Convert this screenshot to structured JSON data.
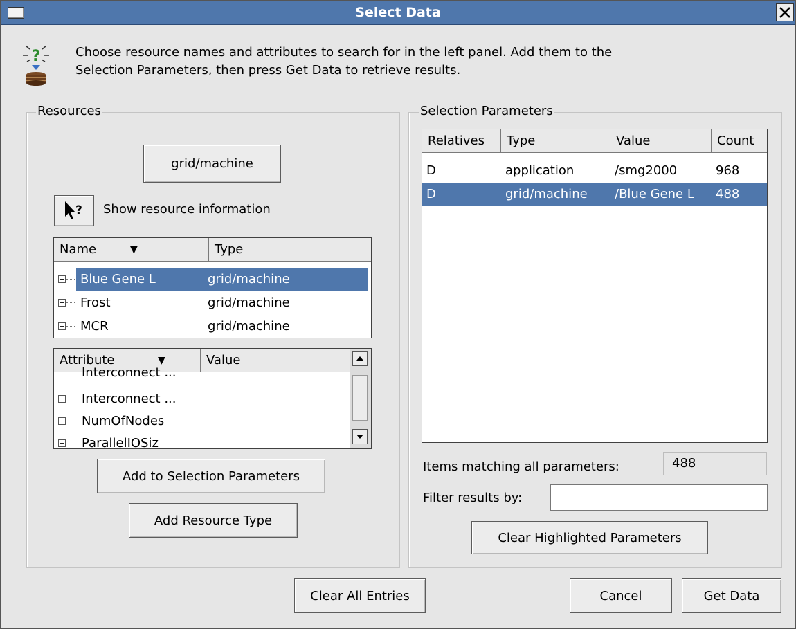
{
  "window": {
    "title": "Select Data"
  },
  "header": {
    "line1": "Choose resource names and attributes to search for in the left panel.  Add them to the",
    "line2": "Selection Parameters, then press Get Data to retrieve results."
  },
  "resources": {
    "group_label": "Resources",
    "type_button": "grid/machine",
    "info_label": "Show resource information",
    "name_table": {
      "columns": [
        "Name",
        "Type"
      ],
      "rows": [
        {
          "name": "Blue Gene L",
          "type": "grid/machine",
          "selected": true
        },
        {
          "name": "Frost",
          "type": "grid/machine",
          "selected": false
        },
        {
          "name": "MCR",
          "type": "grid/machine",
          "selected": false
        }
      ]
    },
    "attribute_table": {
      "columns": [
        "Attribute",
        "Value"
      ],
      "rows": [
        {
          "attribute": "Interconnect ...",
          "value": ""
        },
        {
          "attribute": "Interconnect ...",
          "value": ""
        },
        {
          "attribute": "NumOfNodes",
          "value": ""
        },
        {
          "attribute": "ParallelIOSiz",
          "value": ""
        }
      ]
    },
    "add_selection_button": "Add to Selection Parameters",
    "add_type_button": "Add Resource Type"
  },
  "selection": {
    "group_label": "Selection Parameters",
    "columns": [
      "Relatives",
      "Type",
      "Value",
      "Count"
    ],
    "rows": [
      {
        "relatives": "D",
        "type": "application",
        "value": "/smg2000",
        "count": "968",
        "selected": false
      },
      {
        "relatives": "D",
        "type": "grid/machine",
        "value": "/Blue Gene L",
        "count": "488",
        "selected": true
      }
    ],
    "matching_label": "Items matching all parameters:",
    "matching_value": "488",
    "filter_label": "Filter results by:",
    "filter_value": "",
    "clear_highlighted_button": "Clear Highlighted Parameters"
  },
  "footer": {
    "clear_all": "Clear All Entries",
    "cancel": "Cancel",
    "get_data": "Get Data"
  },
  "colors": {
    "titlebar": "#4f77ac",
    "selection": "#4f77ac",
    "background": "#e6e6e6"
  }
}
